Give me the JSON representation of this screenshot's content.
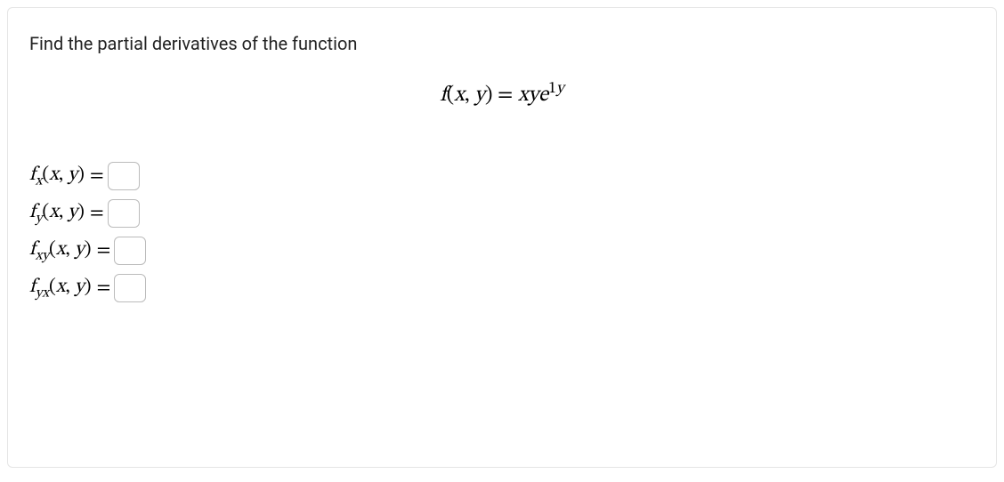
{
  "prompt": "Find the partial derivatives of the function",
  "equation": {
    "lhs_fn": "f",
    "lhs_args": "(x, y)",
    "equals": " = ",
    "rhs_coeff": "xy",
    "rhs_base": "e",
    "rhs_exp": "1y"
  },
  "answers": {
    "fx": {
      "fn": "f",
      "sub": "x",
      "args": "(x, y)",
      "eq": "=",
      "value": ""
    },
    "fy": {
      "fn": "f",
      "sub": "y",
      "args": "(x, y)",
      "eq": "=",
      "value": ""
    },
    "fxy": {
      "fn": "f",
      "sub": "xy",
      "args": "(x, y)",
      "eq": "=",
      "value": ""
    },
    "fyx": {
      "fn": "f",
      "sub": "yx",
      "args": "(x, y)",
      "eq": "=",
      "value": ""
    }
  }
}
